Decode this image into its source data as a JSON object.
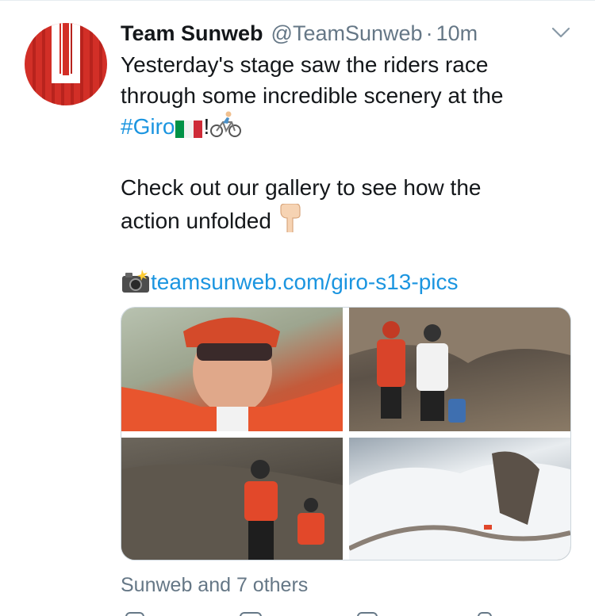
{
  "tweet": {
    "author_name": "Team Sunweb",
    "author_handle": "@TeamSunweb",
    "separator": "·",
    "timestamp": "10m",
    "line1": "Yesterday's stage saw the riders race",
    "line2": "through some incredible scenery at the",
    "hashtag": "#Giro",
    "exclamation": "!",
    "line4": "Check out our gallery to see how the",
    "line5": "action unfolded",
    "link": "teamsunweb.com/giro-s13-pics"
  },
  "engagement": {
    "likes_text": "Sunweb and 7 others"
  },
  "icons": {
    "avatar": "team-sunweb-logo",
    "menu": "chevron-down-icon",
    "flag": "italy-flag-emoji",
    "cyclist": "cyclist-emoji",
    "pointing": "pointing-down-emoji",
    "camera": "camera-flash-emoji"
  },
  "colors": {
    "link": "#1b95e0",
    "secondary_text": "#657786",
    "brand_red": "#d22f27"
  }
}
